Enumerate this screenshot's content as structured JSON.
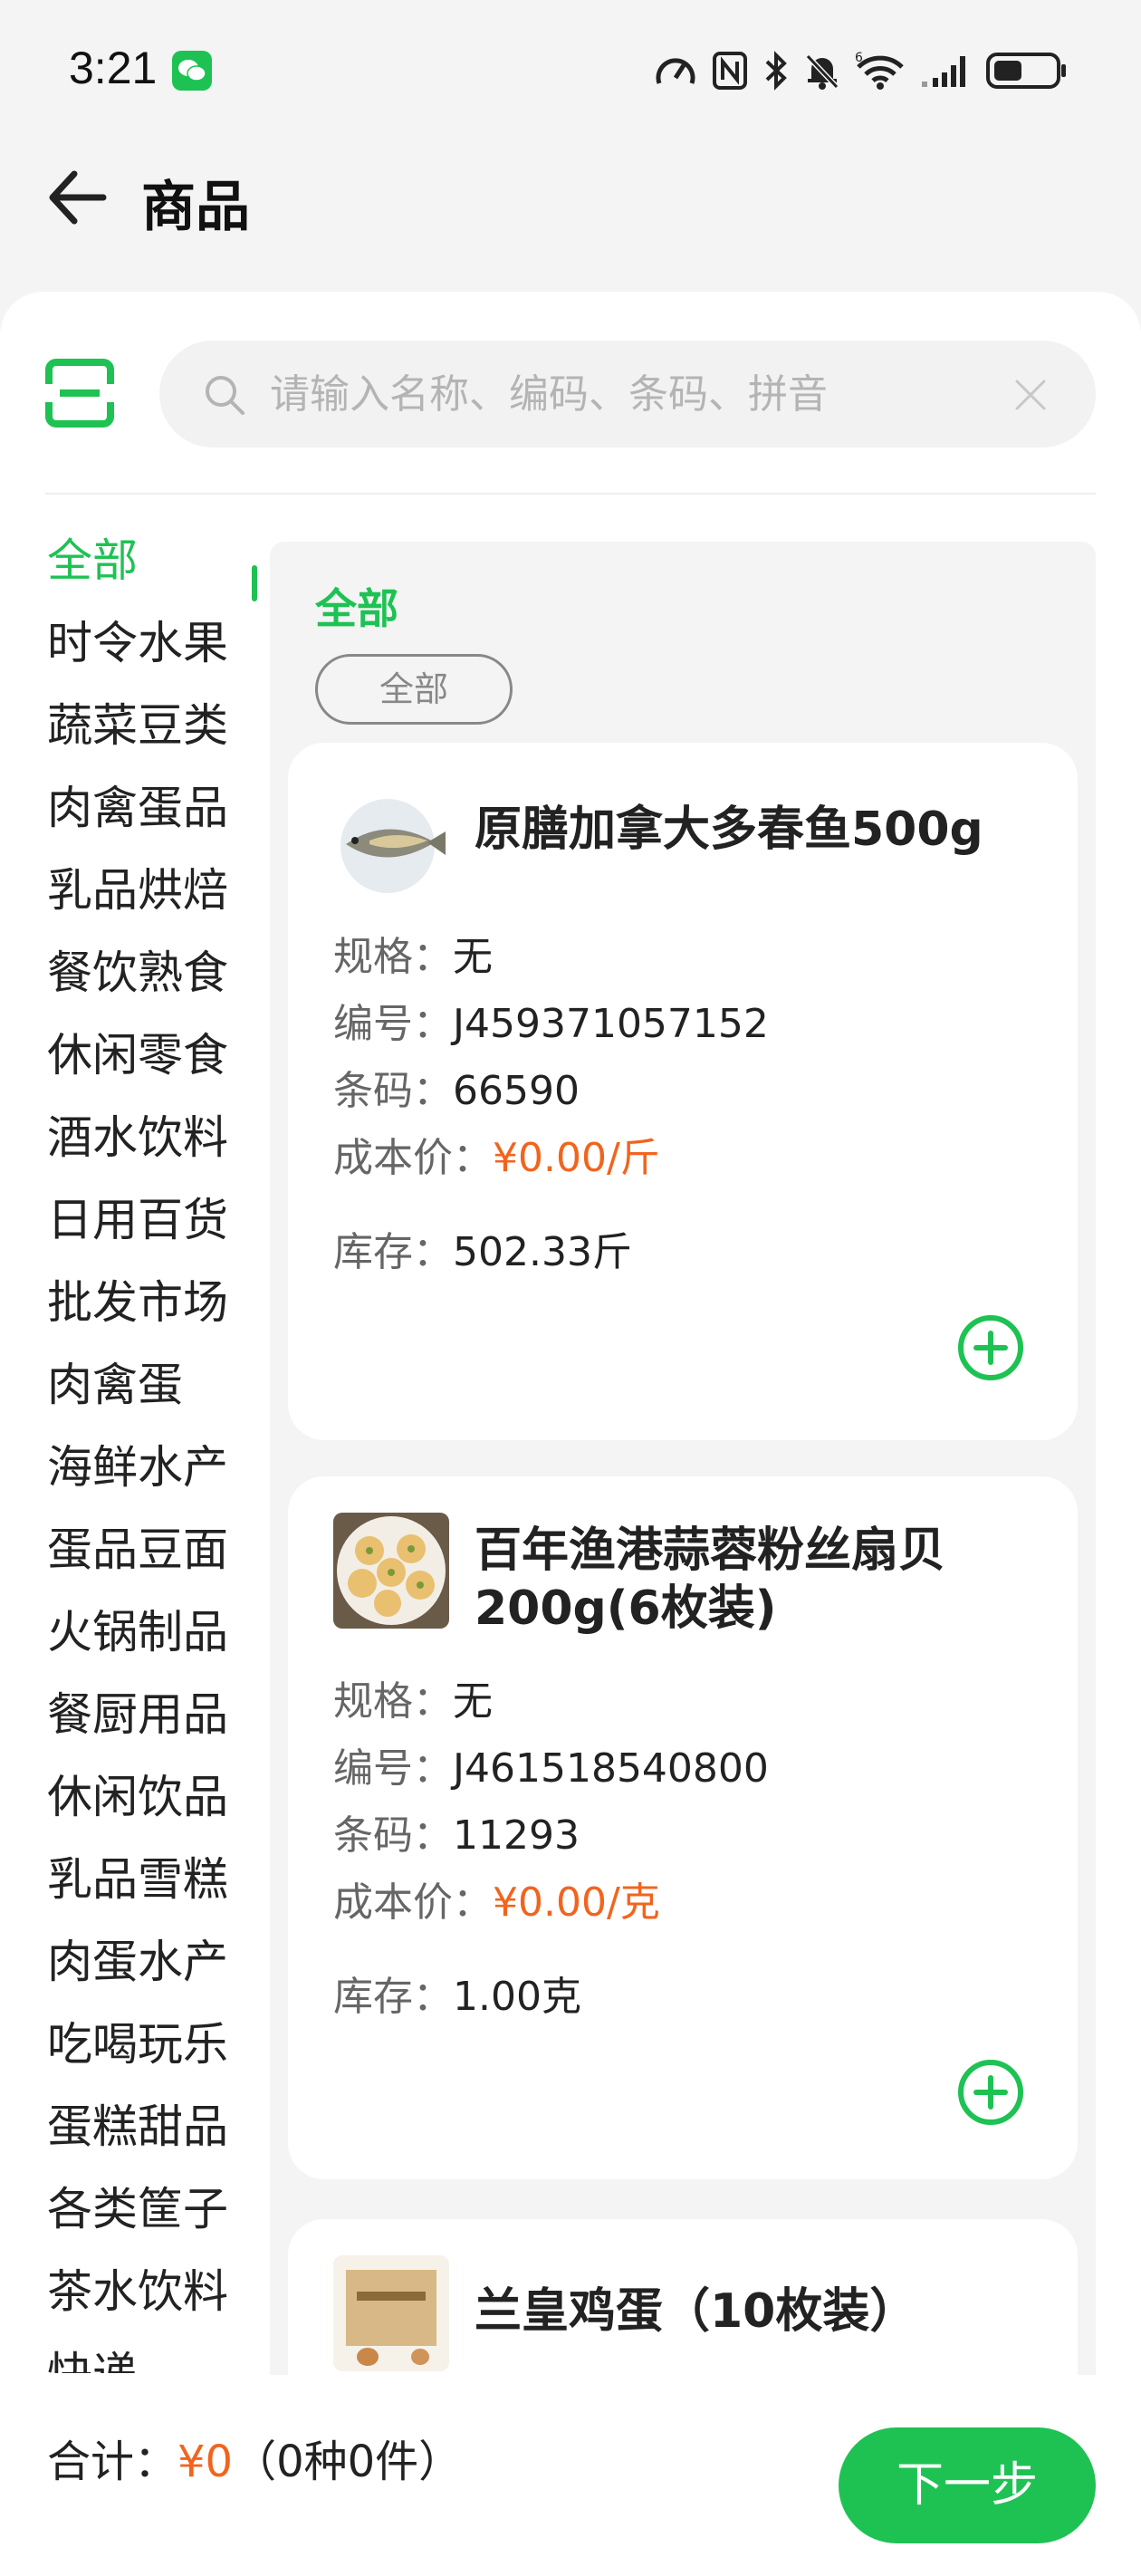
{
  "status_bar": {
    "time": "3:21",
    "signal_label": "6"
  },
  "header": {
    "title": "商品"
  },
  "search": {
    "placeholder": "请输入名称、编码、条码、拼音"
  },
  "categories": [
    "全部",
    "时令水果",
    "蔬菜豆类",
    "肉禽蛋品",
    "乳品烘焙",
    "餐饮熟食",
    "休闲零食",
    "酒水饮料",
    "日用百货",
    "批发市场",
    "肉禽蛋",
    "海鲜水产",
    "蛋品豆面",
    "火锅制品",
    "餐厨用品",
    "休闲饮品",
    "乳品雪糕",
    "肉蛋水产",
    "吃喝玩乐",
    "蛋糕甜品",
    "各类筐子",
    "茶水饮料",
    "快递"
  ],
  "content": {
    "section_title": "全部",
    "chip": "全部"
  },
  "labels": {
    "spec": "规格：",
    "code": "编号：",
    "barcode": "条码：",
    "cost": "成本价：",
    "stock": "库存："
  },
  "products": [
    {
      "name": "原膳加拿大多春鱼500g",
      "spec": "无",
      "code": "J459371057152",
      "barcode": "66590",
      "cost": "¥0.00/斤",
      "stock": "502.33斤"
    },
    {
      "name": "百年渔港蒜蓉粉丝扇贝200g(6枚装)",
      "spec": "无",
      "code": "J461518540800",
      "barcode": "11293",
      "cost": "¥0.00/克",
      "stock": "1.00克"
    },
    {
      "name": "兰皇鸡蛋（10枚装）"
    }
  ],
  "footer": {
    "total_label": "合计：",
    "total_amount": "¥0",
    "total_detail": "（0种0件）",
    "next_label": "下一步"
  },
  "colors": {
    "accent": "#1ec253",
    "price": "#f2641e"
  }
}
